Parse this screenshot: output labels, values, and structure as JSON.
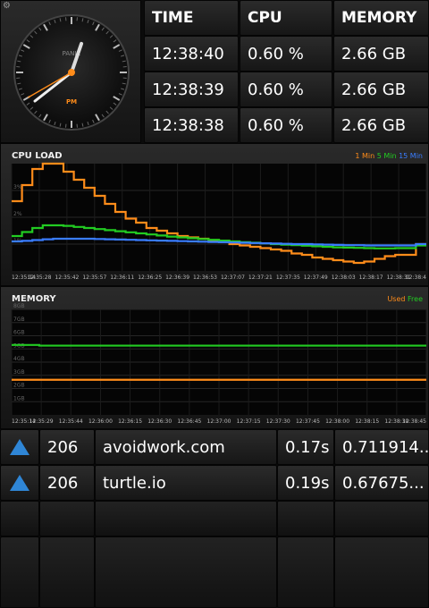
{
  "clock": {
    "brand": "PANIC",
    "ampm": "PM",
    "time": "12:38:40"
  },
  "stats": {
    "headers": [
      "TIME",
      "CPU",
      "MEMORY"
    ],
    "rows": [
      [
        "12:38:40",
        "0.60 %",
        "2.66 GB"
      ],
      [
        "12:38:39",
        "0.60 %",
        "2.66 GB"
      ],
      [
        "12:38:38",
        "0.60 %",
        "2.66 GB"
      ]
    ]
  },
  "colors": {
    "orange": "#ff8c1a",
    "green": "#22cc22",
    "blue": "#3a7dff",
    "accent_arrow": "#2f86d6"
  },
  "chart_data": [
    {
      "type": "line",
      "title": "CPU LOAD",
      "legend": [
        "1 Min",
        "5 Min",
        "15 Min"
      ],
      "legend_placement": "top-right",
      "y_ticks": [
        "1%",
        "2%",
        "3%"
      ],
      "ylim": [
        0,
        4
      ],
      "x_ticks": [
        "12:35:14",
        "12:35:28",
        "12:35:42",
        "12:35:57",
        "12:36:11",
        "12:36:25",
        "12:36:39",
        "12:36:53",
        "12:37:07",
        "12:37:21",
        "12:37:35",
        "12:37:49",
        "12:38:03",
        "12:38:17",
        "12:38:31",
        "12:38:4"
      ],
      "series": [
        {
          "name": "1 Min",
          "color": "#ff8c1a",
          "values": [
            2.6,
            3.2,
            3.8,
            4.0,
            4.0,
            3.7,
            3.4,
            3.1,
            2.8,
            2.5,
            2.2,
            1.95,
            1.8,
            1.6,
            1.5,
            1.4,
            1.3,
            1.25,
            1.2,
            1.15,
            1.1,
            1.0,
            0.95,
            0.9,
            0.85,
            0.8,
            0.75,
            0.65,
            0.6,
            0.5,
            0.45,
            0.4,
            0.35,
            0.3,
            0.35,
            0.45,
            0.55,
            0.6,
            0.6,
            1.0
          ]
        },
        {
          "name": "5 Min",
          "color": "#22cc22",
          "values": [
            1.3,
            1.45,
            1.6,
            1.7,
            1.7,
            1.68,
            1.64,
            1.6,
            1.56,
            1.52,
            1.48,
            1.44,
            1.4,
            1.36,
            1.32,
            1.28,
            1.25,
            1.22,
            1.19,
            1.16,
            1.13,
            1.1,
            1.07,
            1.05,
            1.03,
            1.0,
            0.98,
            0.96,
            0.94,
            0.92,
            0.9,
            0.88,
            0.87,
            0.86,
            0.85,
            0.84,
            0.84,
            0.85,
            0.85,
            0.95
          ]
        },
        {
          "name": "15 Min",
          "color": "#3a7dff",
          "values": [
            1.1,
            1.12,
            1.15,
            1.18,
            1.2,
            1.2,
            1.2,
            1.2,
            1.19,
            1.18,
            1.17,
            1.16,
            1.15,
            1.14,
            1.13,
            1.12,
            1.11,
            1.1,
            1.09,
            1.08,
            1.07,
            1.06,
            1.05,
            1.04,
            1.03,
            1.02,
            1.01,
            1.0,
            1.0,
            0.99,
            0.98,
            0.97,
            0.96,
            0.96,
            0.95,
            0.95,
            0.95,
            0.95,
            0.95,
            1.0
          ]
        }
      ]
    },
    {
      "type": "line",
      "title": "MEMORY",
      "legend": [
        "Used",
        "Free"
      ],
      "legend_placement": "top-right",
      "y_ticks": [
        "1GB",
        "2GB",
        "3GB",
        "4GB",
        "5GB",
        "6GB",
        "7GB",
        "8GB"
      ],
      "ylim": [
        0,
        8
      ],
      "x_ticks": [
        "12:35:14",
        "12:35:29",
        "12:35:44",
        "12:36:00",
        "12:36:15",
        "12:36:30",
        "12:36:45",
        "12:37:00",
        "12:37:15",
        "12:37:30",
        "12:37:45",
        "12:38:00",
        "12:38:15",
        "12:38:30",
        "12:38:45"
      ],
      "series": [
        {
          "name": "Used",
          "color": "#ff8c1a",
          "values": [
            2.66,
            2.66,
            2.66,
            2.66,
            2.66,
            2.66,
            2.66,
            2.66,
            2.66,
            2.66,
            2.66,
            2.66,
            2.66,
            2.66,
            2.66
          ]
        },
        {
          "name": "Free",
          "color": "#22cc22",
          "values": [
            5.3,
            5.25,
            5.25,
            5.25,
            5.25,
            5.25,
            5.25,
            5.25,
            5.25,
            5.25,
            5.25,
            5.25,
            5.25,
            5.25,
            5.25
          ]
        }
      ]
    }
  ],
  "ping": {
    "rows": [
      {
        "icon": "up-triangle-icon",
        "code": "206",
        "host": "avoidwork.com",
        "time": "0.17s",
        "value": "0.711914..."
      },
      {
        "icon": "up-triangle-icon",
        "code": "206",
        "host": "turtle.io",
        "time": "0.19s",
        "value": "0.67675..."
      }
    ]
  }
}
